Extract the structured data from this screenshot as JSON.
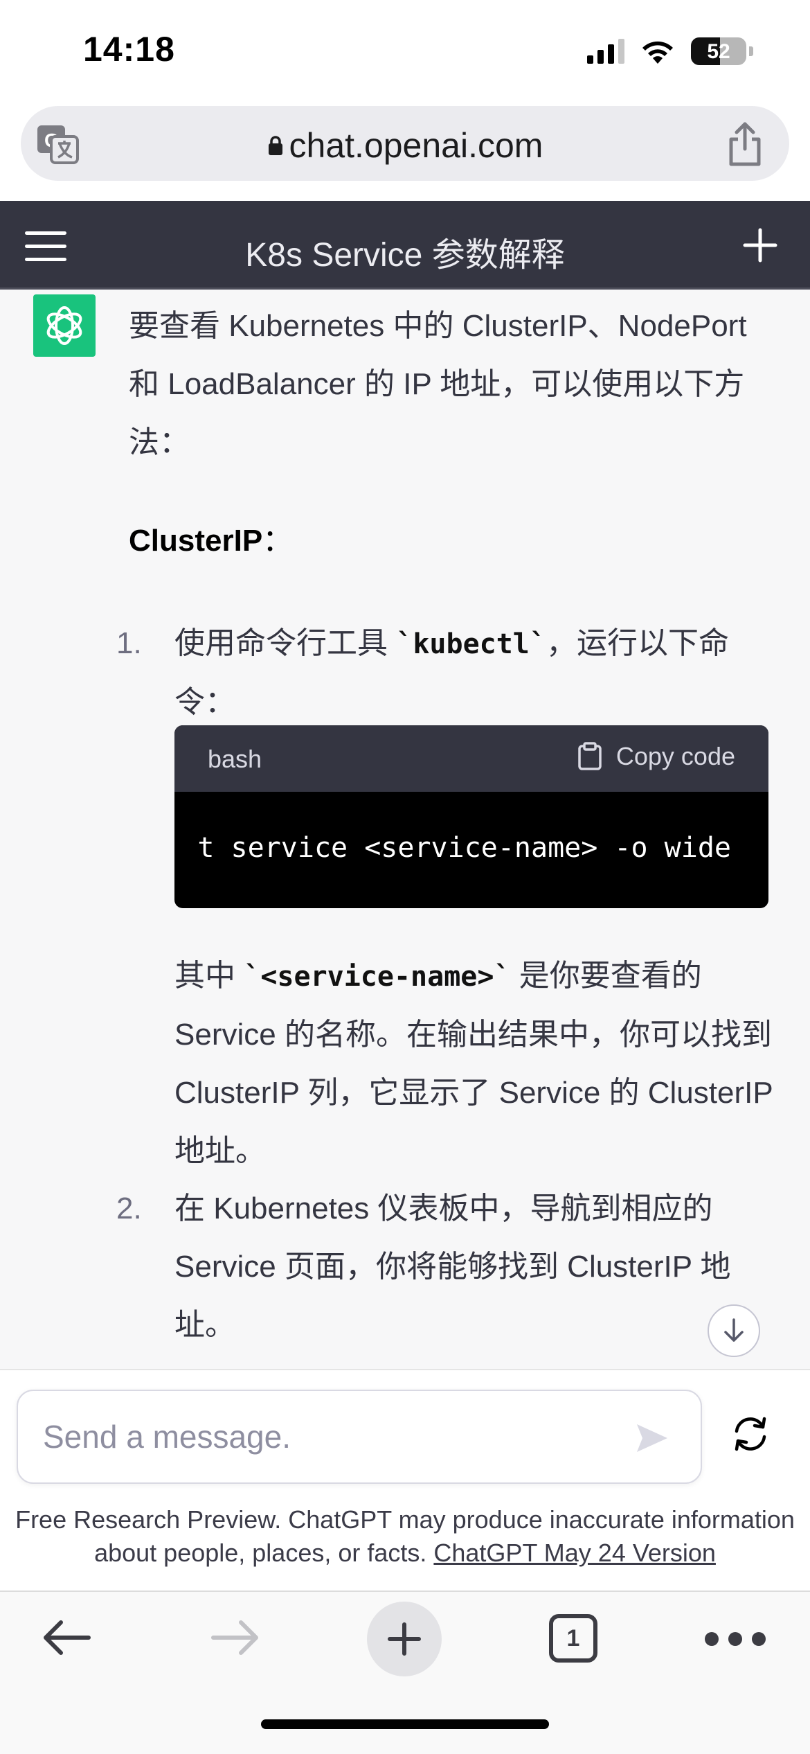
{
  "status_bar": {
    "time": "14:18",
    "battery_percent": "52",
    "icons": [
      "cellular-signal-icon",
      "wifi-icon",
      "battery-icon"
    ]
  },
  "browser": {
    "url": "chat.openai.com",
    "icons": [
      "translate-icon",
      "lock-icon",
      "share-icon"
    ]
  },
  "nav": {
    "title": "K8s Service 参数解释",
    "icons": [
      "menu-icon",
      "plus-icon"
    ]
  },
  "message": {
    "intro": "要查看 Kubernetes 中的 ClusterIP、NodePort 和 LoadBalancer 的 IP 地址，可以使用以下方法：",
    "heading": "ClusterIP",
    "heading_suffix": "：",
    "items": [
      {
        "number": "1.",
        "text_before": "使用命令行工具 ",
        "code": "`kubectl`",
        "text_after": "，运行以下命令：",
        "code_block": {
          "language": "bash",
          "copy_label": "Copy code",
          "visible_line": "t service <service-name> -o wide"
        },
        "followup_before": "其中 ",
        "followup_code": "`<service-name>`",
        "followup_after": " 是你要查看的 Service 的名称。在输出结果中，你可以找到 ClusterIP 列，它显示了 Service 的 ClusterIP 地址。"
      },
      {
        "number": "2.",
        "text": "在 Kubernetes 仪表板中，导航到相应的 Service 页面，你将能够找到 ClusterIP 地址。"
      }
    ]
  },
  "composer": {
    "placeholder": "Send a message.",
    "disclaimer": "Free Research Preview. ChatGPT may produce inaccurate information about people, places, or facts. ",
    "version_link": "ChatGPT May 24 Version"
  },
  "toolbar": {
    "tab_count": "1"
  },
  "colors": {
    "nav_bg": "#343541",
    "chat_bg": "#f7f7f8",
    "avatar_bg": "#19c37d",
    "code_bg": "#000000"
  }
}
